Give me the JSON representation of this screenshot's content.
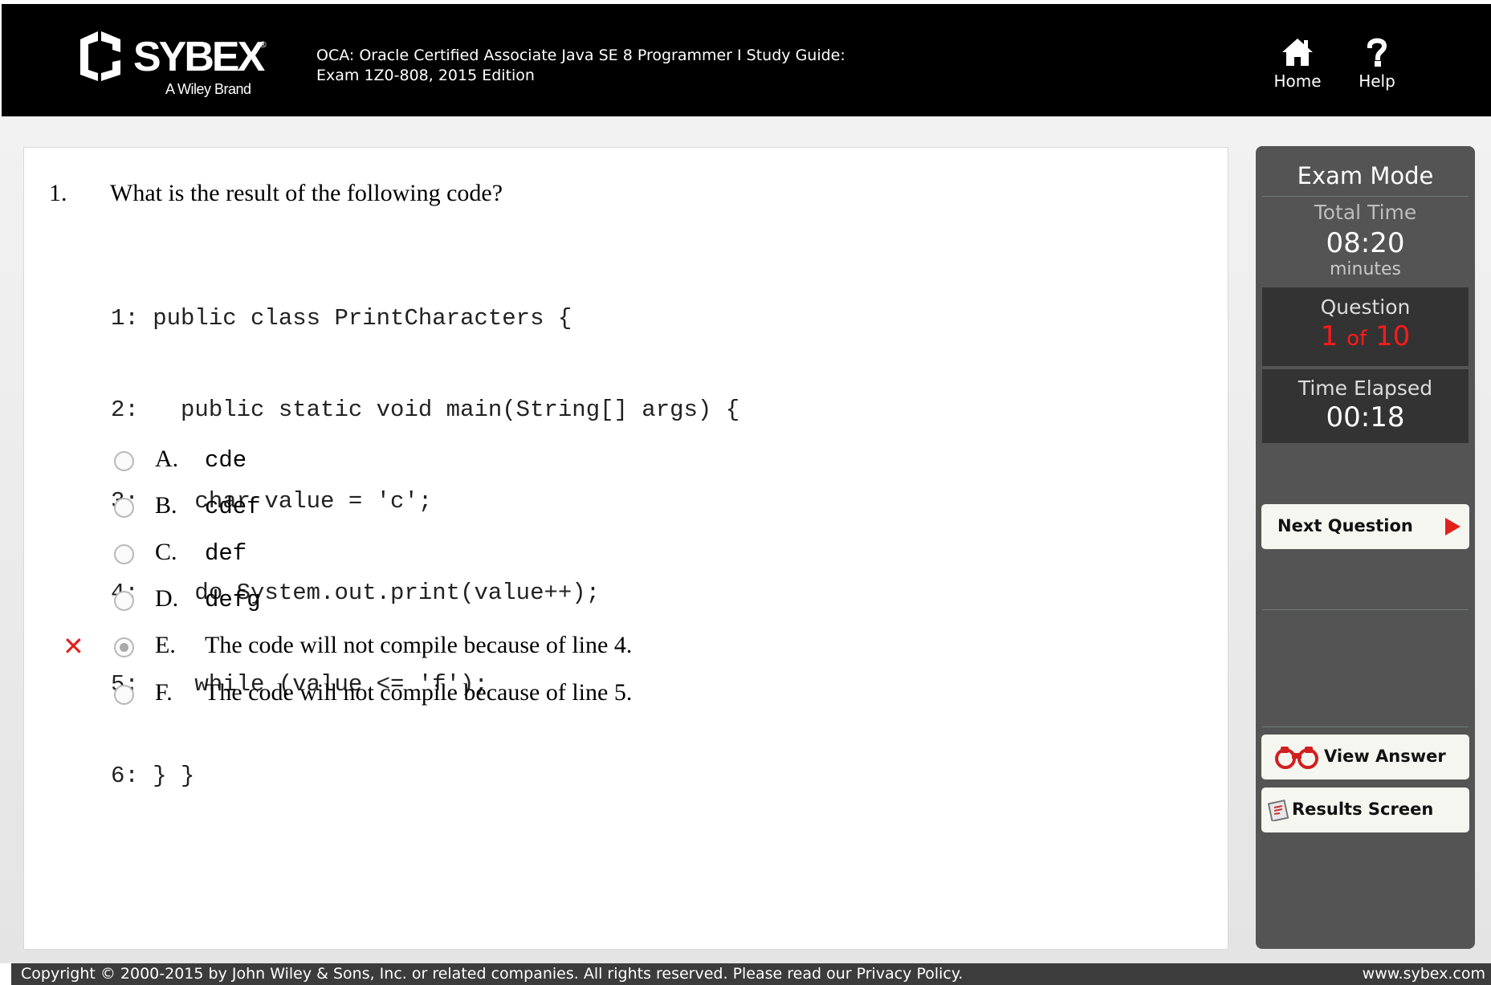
{
  "header": {
    "brand": "SYBEX",
    "brand_mark": "®",
    "brand_tagline": "A Wiley Brand",
    "title_line1": "OCA: Oracle Certified Associate Java SE 8 Programmer I Study Guide:",
    "title_line2": "Exam 1Z0-808, 2015 Edition",
    "nav": {
      "home_label": "Home",
      "help_label": "Help"
    }
  },
  "question": {
    "number": "1.",
    "text": "What is the result of the following code?",
    "code": [
      "1: public class PrintCharacters {",
      "2:   public static void main(String[] args) {",
      "3:    char value = 'c';",
      "4:    do System.out.print(value++);",
      "5:    while (value <= 'f');",
      "6: } }"
    ],
    "options": [
      {
        "letter": "A.",
        "text": "cde"
      },
      {
        "letter": "B.",
        "text": "cdef"
      },
      {
        "letter": "C.",
        "text": "def"
      },
      {
        "letter": "D.",
        "text": "defg"
      },
      {
        "letter": "E.",
        "text": "The code will not compile because of line 4."
      },
      {
        "letter": "F.",
        "text": "The code will not compile because of line 5."
      }
    ],
    "selected_option": "E.",
    "wrong_marker": "✕"
  },
  "sidebar": {
    "mode_title": "Exam Mode",
    "total_time_label": "Total Time",
    "total_time_value": "08:20",
    "total_time_unit": "minutes",
    "question_label": "Question",
    "question_current": "1",
    "question_of": "of",
    "question_total": "10",
    "elapsed_label": "Time Elapsed",
    "elapsed_value": "00:18",
    "next_label": "Next Question",
    "view_answer_label": "View Answer",
    "results_label": "Results Screen"
  },
  "footer": {
    "copyright": "Copyright © 2000-2015 by John Wiley & Sons, Inc. or related companies. All rights reserved. Please read our Privacy Policy.",
    "site": "www.sybex.com"
  },
  "colors": {
    "header_bg": "#000000",
    "sidebar_bg": "#545454",
    "accent_red": "#e0201c",
    "progress_red": "#ff1a1a"
  },
  "icons": [
    "sybex-logo-icon",
    "home-icon",
    "help-icon",
    "play-arrow-icon",
    "binoculars-icon",
    "results-clipboard-icon",
    "wrong-answer-icon"
  ]
}
